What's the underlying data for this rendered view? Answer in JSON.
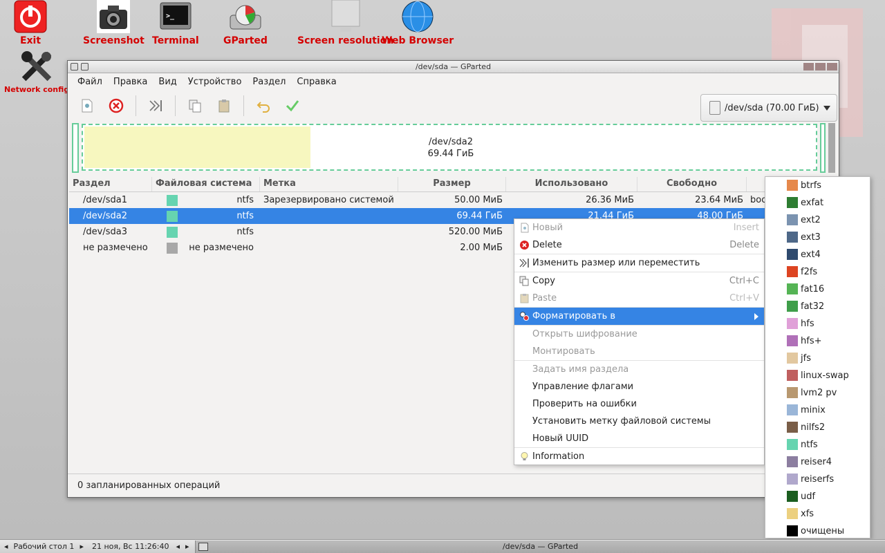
{
  "desktop": {
    "icons": [
      {
        "label": "Exit",
        "icon": "power-icon"
      },
      {
        "label": "Screenshot",
        "icon": "camera-icon"
      },
      {
        "label": "Terminal",
        "icon": "terminal-icon"
      },
      {
        "label": "GParted",
        "icon": "gparted-icon"
      },
      {
        "label": "Screen resolution",
        "icon": "monitor-icon"
      },
      {
        "label": "Web Browser",
        "icon": "globe-icon"
      },
      {
        "label": "Network config",
        "icon": "wrench-icon"
      }
    ]
  },
  "window": {
    "title": "/dev/sda — GParted",
    "menu": [
      "Файл",
      "Правка",
      "Вид",
      "Устройство",
      "Раздел",
      "Справка"
    ],
    "device_selector": "/dev/sda (70.00 ГиБ)"
  },
  "diskmap": {
    "name": "/dev/sda2",
    "size": "69.44 ГиБ",
    "used_fraction": 0.31
  },
  "table": {
    "headers": [
      "Раздел",
      "Файловая система",
      "Метка",
      "Размер",
      "Использовано",
      "Свободно",
      ""
    ],
    "rows": [
      {
        "partition": "/dev/sda1",
        "fs": "ntfs",
        "fs_color": "#66d4b0",
        "label": "Зарезервировано системой",
        "size": "50.00 МиБ",
        "used": "26.36 МиБ",
        "free": "23.64 МиБ",
        "flags": "boo"
      },
      {
        "partition": "/dev/sda2",
        "fs": "ntfs",
        "fs_color": "#66d4b0",
        "label": "",
        "size": "69.44 ГиБ",
        "used": "21.44 ГиБ",
        "free": "48.00 ГиБ",
        "flags": ""
      },
      {
        "partition": "/dev/sda3",
        "fs": "ntfs",
        "fs_color": "#66d4b0",
        "label": "",
        "size": "520.00 МиБ",
        "used": "",
        "free": "",
        "flags": ""
      },
      {
        "partition": "не размечено",
        "fs": "не размечено",
        "fs_color": "#a8a8a8",
        "label": "",
        "size": "2.00 МиБ",
        "used": "",
        "free": "",
        "flags": ""
      }
    ]
  },
  "status": "0 запланированных операций",
  "context_menu": {
    "new": {
      "label": "Новый",
      "shortcut": "Insert"
    },
    "delete": {
      "label": "Delete",
      "shortcut": "Delete"
    },
    "resize": {
      "label": "Изменить размер или переместить"
    },
    "copy": {
      "label": "Copy",
      "shortcut": "Ctrl+C"
    },
    "paste": {
      "label": "Paste",
      "shortcut": "Ctrl+V"
    },
    "format": {
      "label": "Форматировать в"
    },
    "open_crypt": {
      "label": "Открыть шифрование"
    },
    "mount": {
      "label": "Монтировать"
    },
    "name": {
      "label": "Задать имя раздела"
    },
    "flags": {
      "label": "Управление флагами"
    },
    "check": {
      "label": "Проверить на ошибки"
    },
    "label": {
      "label": "Установить метку файловой системы"
    },
    "uuid": {
      "label": "Новый UUID"
    },
    "info": {
      "label": "Information"
    }
  },
  "format_submenu": [
    {
      "name": "btrfs",
      "color": "#e6894c"
    },
    {
      "name": "exfat",
      "color": "#2e7d32"
    },
    {
      "name": "ext2",
      "color": "#7b93b0"
    },
    {
      "name": "ext3",
      "color": "#4e6888"
    },
    {
      "name": "ext4",
      "color": "#2f4a6e"
    },
    {
      "name": "f2fs",
      "color": "#dd4422"
    },
    {
      "name": "fat16",
      "color": "#55b455"
    },
    {
      "name": "fat32",
      "color": "#3f9e4a"
    },
    {
      "name": "hfs",
      "color": "#e0a0d8"
    },
    {
      "name": "hfs+",
      "color": "#b070b8"
    },
    {
      "name": "jfs",
      "color": "#e2c8a0"
    },
    {
      "name": "linux-swap",
      "color": "#c06060"
    },
    {
      "name": "lvm2 pv",
      "color": "#b89870"
    },
    {
      "name": "minix",
      "color": "#9ab6d8"
    },
    {
      "name": "nilfs2",
      "color": "#7a5e48"
    },
    {
      "name": "ntfs",
      "color": "#66d4b0"
    },
    {
      "name": "reiser4",
      "color": "#8c7ea0"
    },
    {
      "name": "reiserfs",
      "color": "#b0a8cc"
    },
    {
      "name": "udf",
      "color": "#1b5e20"
    },
    {
      "name": "xfs",
      "color": "#ecd080"
    },
    {
      "name": "очищены",
      "color": "#000000"
    }
  ],
  "taskbar": {
    "desktop": "Рабочий стол 1",
    "clock": "21 ноя, Вс 11:26:40",
    "task": "/dev/sda — GParted"
  }
}
